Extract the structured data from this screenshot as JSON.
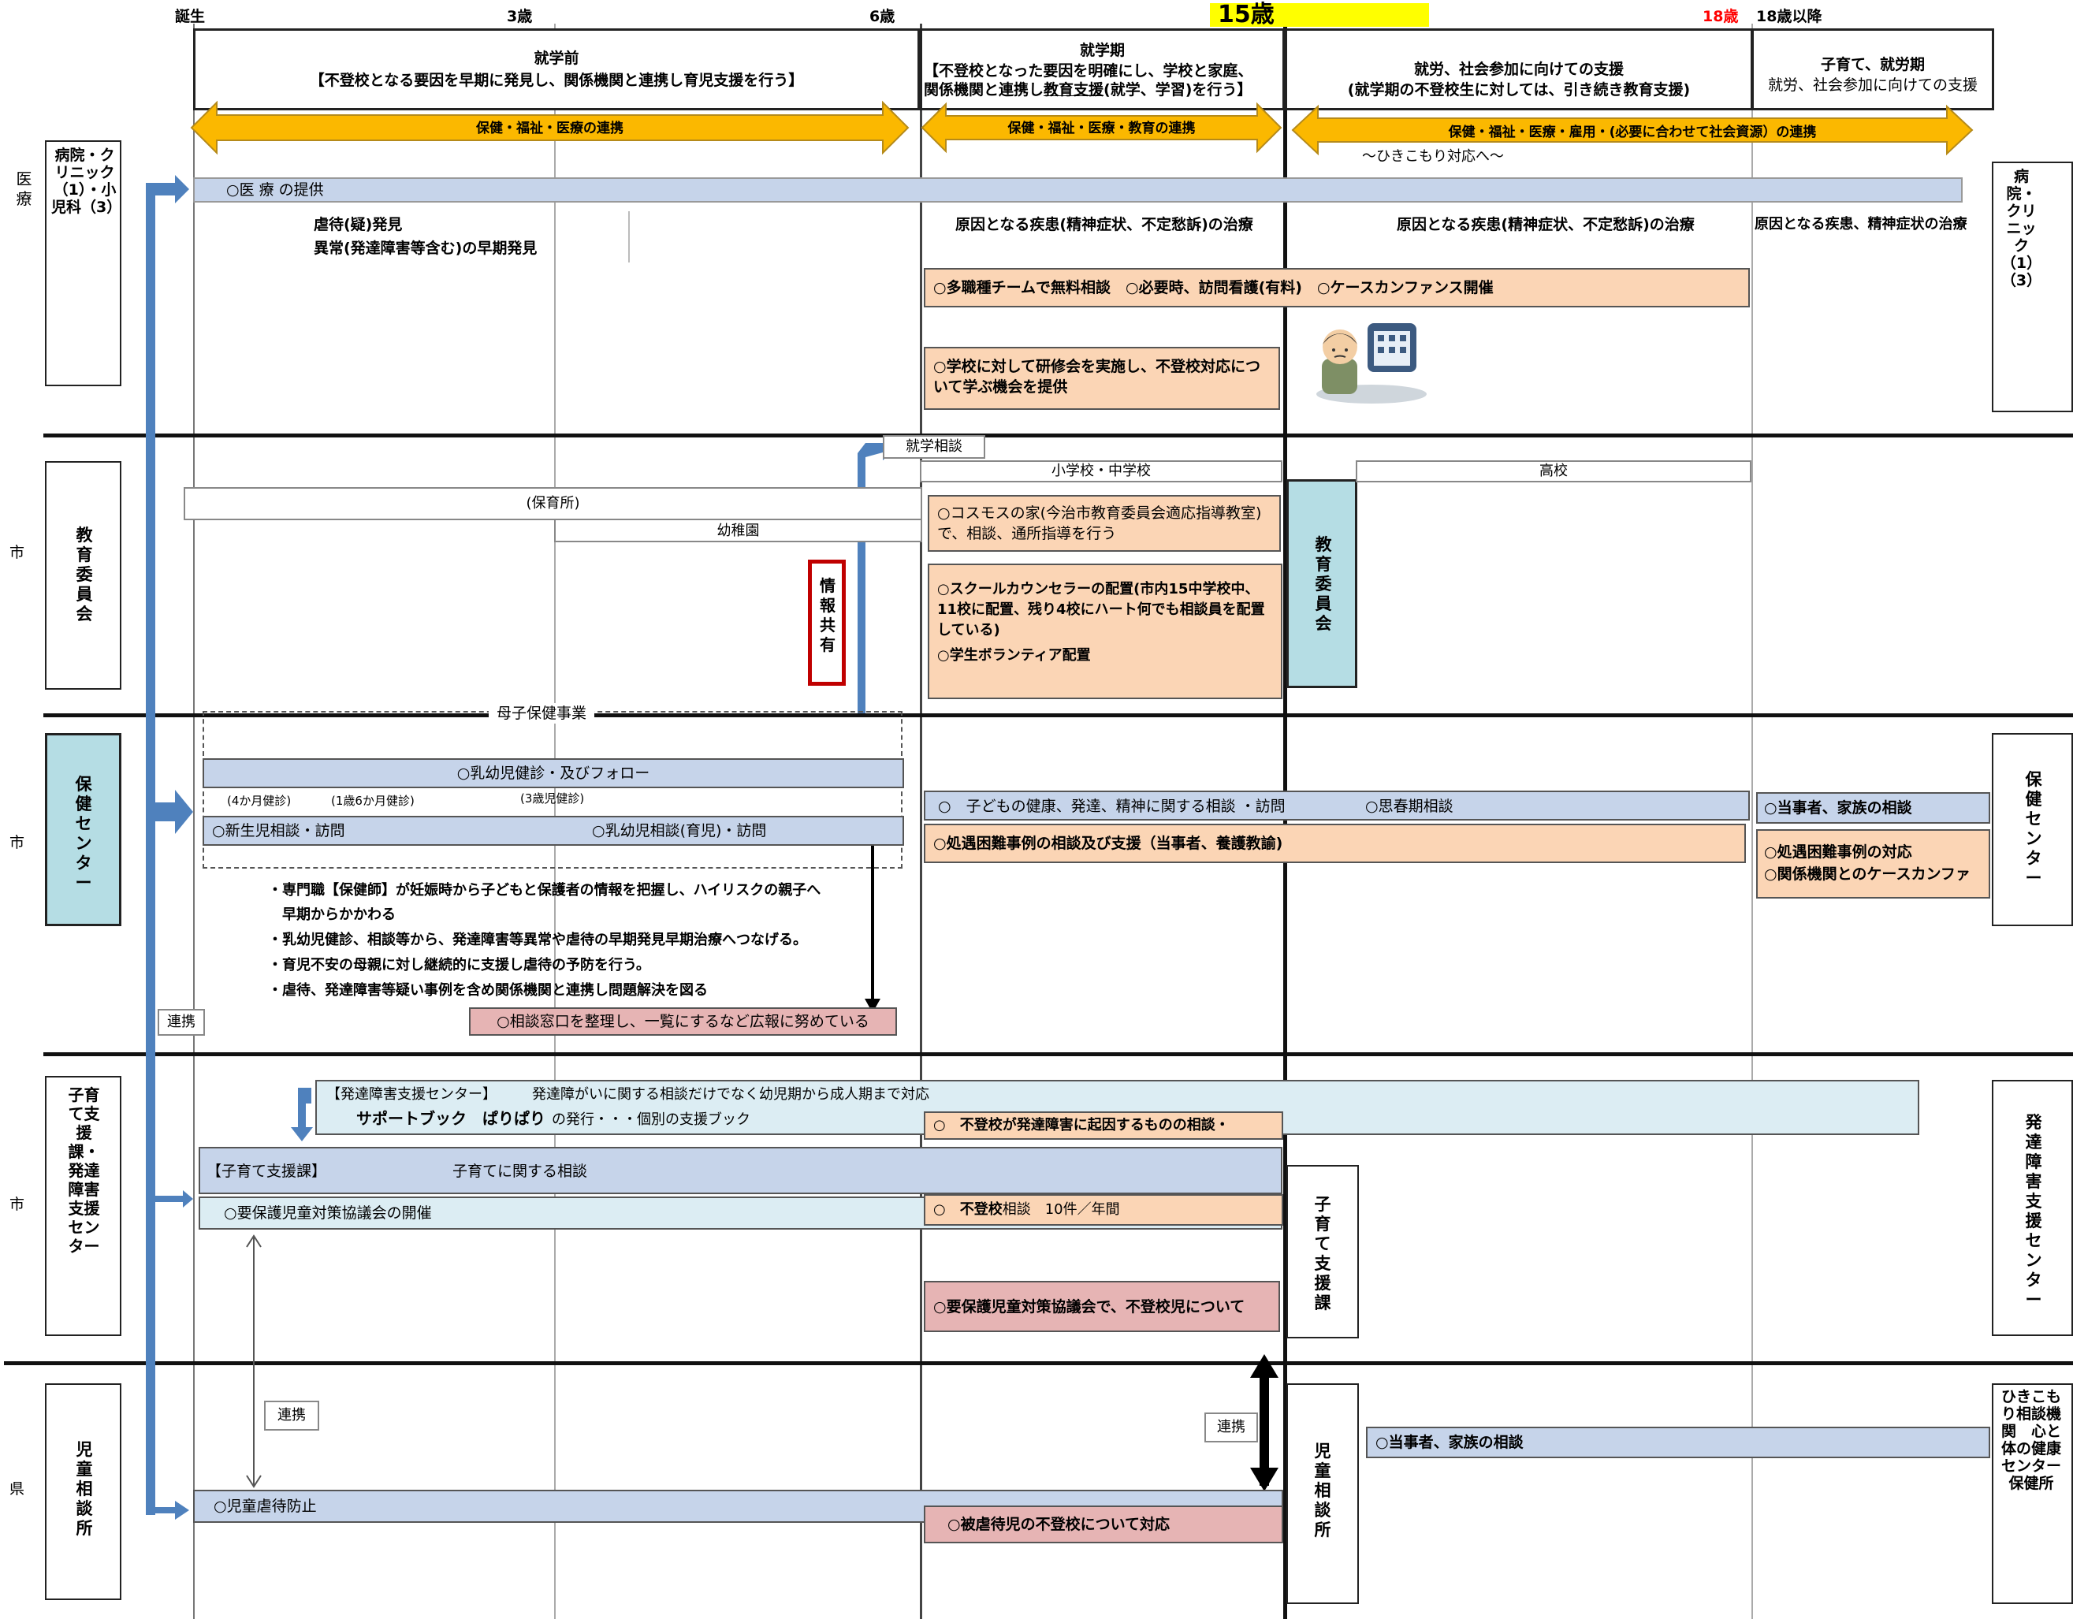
{
  "ages": {
    "birth": "誕生",
    "a3": "3歳",
    "a6": "6歳",
    "a15": "15歳",
    "a18": "18歳",
    "a18plus": "18歳以降"
  },
  "colors": {
    "orange_arrow": "#fbb800",
    "blue_arrow": "#4f81bd",
    "yellow_hl": "#ffff00",
    "red_text": "#ff0000"
  },
  "periods": {
    "preschool": {
      "title": "就学前",
      "desc": "【不登校となる要因を早期に発見し、関係機関と連携し育児支援を行う】"
    },
    "school": {
      "title": "就学期",
      "desc1": "【不登校となった要因を明確にし、学校と家庭、",
      "desc2a": "関係機関と連携し",
      "desc2b": "教育支援",
      "desc2c": "(就学、学習)を行う】"
    },
    "work": {
      "title": "就労、社会参加に向けての支援",
      "desc": "(就学期の不登校生に対しては、引き続き教育支援)"
    },
    "parenting": {
      "title": "子育て、就労期",
      "desc": "就労、社会参加に向けての支援"
    }
  },
  "arrows": {
    "a1": "保健・福祉・医療の連携",
    "a2": "保健・福祉・医療・教育の連携",
    "a3": "保健・福祉・医療・雇用・(必要に合わせて社会資源）の連携",
    "hikikomori": "～ひきこもり対応へ～"
  },
  "rows": {
    "medical": {
      "side_label": "医療",
      "org": "病院・クリニック（1）・小児科（3）",
      "org_right": "病院・クリニック（1）（3）",
      "provide": "○医 療 の提供",
      "abuse1": "虐待(疑)発見",
      "abuse2": "異常(発達障害等含む)の早期発見",
      "cause1": "原因となる疾患(精神症状、不定愁訴)の治療",
      "cause2": "原因となる疾患(精神症状、不定愁訴)の治療",
      "cause3": "原因となる疾患、精神症状の治療",
      "team": "○多職種チームで無料相談　○必要時、訪問看護(有料)　○ケースカンファンス開催",
      "training": "○学校に対して研修会を実施し、不登校対応について学ぶ機会を提供"
    },
    "education": {
      "side_label": "市",
      "org": "教育委員会",
      "org_mid": "教育委員会",
      "consult": "就学相談",
      "elem": "小学校・中学校",
      "high": "高校",
      "nursery": "(保育所)",
      "kinder": "幼稚園",
      "share": "情報共有",
      "cosmos": "○コスモスの家(今治市教育委員会適応指導教室)で、相談、通所指導を行う",
      "counselor1": "○スクールカウンセラーの配置(市内15中学校中、11校に配置、残り4校にハート何でも相談員を配置している)",
      "counselor2": "○学生ボランティア配置"
    },
    "health": {
      "side_label": "市",
      "org": "保健センター",
      "org_right": "保健センター",
      "maternal": "母子保健事業",
      "checkup": "○乳幼児健診・及びフォロー",
      "c1": "(4か月健診)",
      "c2": "(1歳6か月健診)",
      "c3": "(3歳児健診)",
      "newborn": "○新生児相談・訪問",
      "infant": "○乳幼児相談(育児)・訪問",
      "child": "○　子どもの健康、発達、精神に関する相談 ・訪問",
      "puberty": "○思春期相談",
      "difficult": "○処遇困難事例の相談及び支援（当事者、養護教諭)",
      "family": "○当事者、家族の相談",
      "difficult2": "○処遇困難事例の対応",
      "case": "○関係機関とのケースカンファ",
      "notes": [
        "・専門職【保健師】が妊娠時から子どもと保護者の情報を把握し、ハイリスクの親子へ",
        "　早期からかかわる",
        "・乳幼児健診、相談等から、発達障害等異常や虐待の早期発見早期治療へつなげる。",
        "・育児不安の母親に対し継続的に支援し虐待の予防を行う。",
        "・虐待、発達障害等疑い事例を含め関係機関と連携し問題解決を図る"
      ],
      "window": "○相談窓口を整理し、一覧にするなど広報に努めている",
      "link": "連携"
    },
    "development": {
      "side_label": "市",
      "org": "子育て支援課・発達障害支援センター",
      "org_mid": "子育て支援課",
      "org_right": "発達障害支援センター",
      "center": "【発達障害支援センター】　　　発達障がいに関する相談だけでなく幼児期から成人期まで対応",
      "book_name": "サポートブック　ぱりぱり",
      "book_desc": "の発行・・・個別の支援ブック",
      "dev_cause": "○　不登校が発達障害に起因するものの相談・",
      "support_section": "【子育て支援課】",
      "support_desc": "子育てに関する相談",
      "council": "○要保護児童対策協議会の開催",
      "absent_a": "○　",
      "absent_b": "不登校",
      "absent_c": "相談　10件／年間",
      "council2": "○要保護児童対策協議会で、不登校児について"
    },
    "prefecture": {
      "side_label": "県",
      "org": "児童相談所",
      "org_mid": "児童相談所",
      "org_right": "ひきこもり相談機関　心と体の健康センター　保健所",
      "link1": "連携",
      "link2": "連携",
      "family": "○当事者、家族の相談",
      "prevent": "○児童虐待防止",
      "abused": "○被虐待児の不登校について対応"
    }
  }
}
